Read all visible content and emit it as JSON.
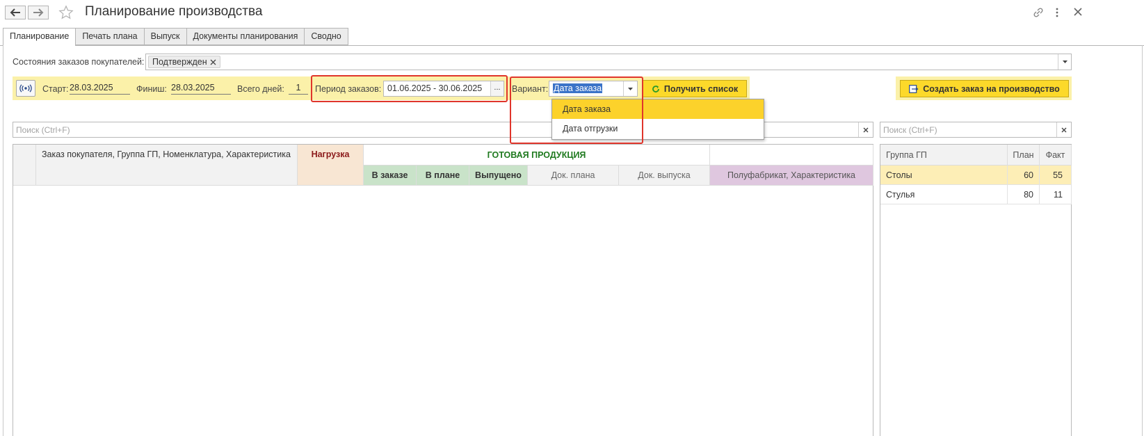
{
  "window": {
    "title": "Планирование производства"
  },
  "tabs": [
    {
      "label": "Планирование",
      "active": true
    },
    {
      "label": "Печать плана",
      "active": false
    },
    {
      "label": "Выпуск",
      "active": false
    },
    {
      "label": "Документы планирования",
      "active": false
    },
    {
      "label": "Сводно",
      "active": false
    }
  ],
  "filters": {
    "order_states_label": "Состояния заказов покупателей:",
    "order_states_tag": "Подтвержден",
    "start_label": "Старт:",
    "start_value": "28.03.2025",
    "finish_label": "Финиш:",
    "finish_value": "28.03.2025",
    "days_label": "Всего дней:",
    "days_value": "1",
    "period_label": "Период заказов:",
    "period_value": "01.06.2025 - 30.06.2025",
    "period_btn": "...",
    "variant_label": "Вариант:",
    "variant_value": "Дата заказа",
    "get_list_btn": "Получить список",
    "create_order_btn": "Создать заказ на производство"
  },
  "variant_options": [
    "Дата заказа",
    "Дата отгрузки"
  ],
  "search": {
    "main_placeholder": "Поиск (Ctrl+F)",
    "side_placeholder": "Поиск (Ctrl+F)"
  },
  "main_table": {
    "col_order": "Заказ покупателя, Группа ГП, Номенклатура, Характеристика",
    "col_load": "Нагрузка",
    "group_finished": "ГОТОВАЯ ПРОДУКЦИЯ",
    "col_in_order": "В заказе",
    "col_in_plan": "В плане",
    "col_released": "Выпущено",
    "col_plan_doc": "Док. плана",
    "col_release_doc": "Док. выпуска",
    "col_semi": "Полуфабрикат, Характеристика"
  },
  "side_table": {
    "headers": [
      "Группа ГП",
      "План",
      "Факт"
    ],
    "rows": [
      {
        "group": "Столы",
        "plan": "60",
        "fact": "55"
      },
      {
        "group": "Стулья",
        "plan": "80",
        "fact": "11"
      }
    ]
  },
  "colors": {
    "accent_yellow": "#fcd92a",
    "highlight_red": "#e0352b",
    "load_header": "#f8e6d3",
    "finished_header": "#c9e3c9",
    "semi_header": "#dfc7df"
  }
}
